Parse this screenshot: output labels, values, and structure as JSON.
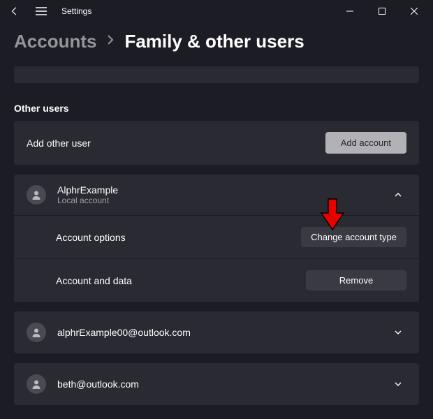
{
  "window": {
    "title": "Settings"
  },
  "breadcrumb": {
    "parent": "Accounts",
    "current": "Family & other users"
  },
  "section": {
    "heading": "Other users",
    "add_label": "Add other user",
    "add_button": "Add account"
  },
  "expanded_user": {
    "name": "AlphrExample",
    "subtitle": "Local account",
    "options_label": "Account options",
    "options_button": "Change account type",
    "data_label": "Account and data",
    "data_button": "Remove"
  },
  "users": [
    {
      "email": "alphrExample00@outlook.com"
    },
    {
      "email": "beth@outlook.com"
    }
  ]
}
